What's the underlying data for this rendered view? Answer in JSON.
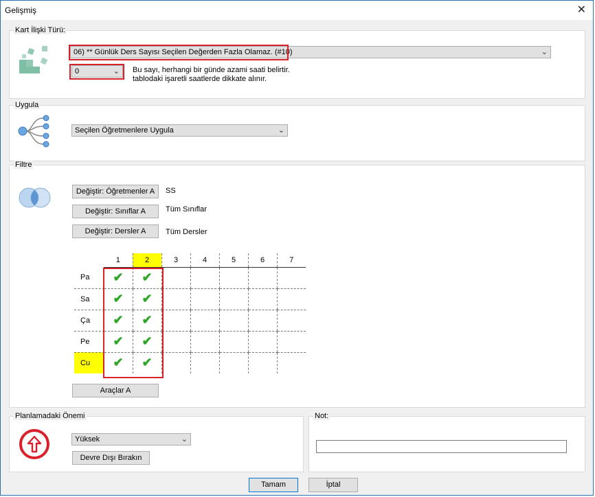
{
  "window": {
    "title": "Gelişmiş",
    "close_glyph": "✕"
  },
  "relation": {
    "legend": "Kart İlişki Türü:",
    "type_value": "06) ** Günlük Ders Sayısı Seçilen Değerden Fazla Olamaz. (#10)",
    "count_value": "0",
    "help_line1": "Bu sayı, herhangi bir günde azami saati belirtir.",
    "help_line2": "tablodaki işaretli saatlerde dikkate alınır."
  },
  "apply": {
    "legend": "Uygula",
    "value": "Seçilen Öğretmenlere Uygula"
  },
  "filter": {
    "legend": "Filtre",
    "rows": [
      {
        "button": "Değiştir: Öğretmenler A",
        "value": "SS"
      },
      {
        "button": "Değiştir: Sınıflar A",
        "value": "Tüm Sınıflar"
      },
      {
        "button": "Değiştir: Dersler A",
        "value": "Tüm Dersler"
      }
    ],
    "periods": [
      "1",
      "2",
      "3",
      "4",
      "5",
      "6",
      "7"
    ],
    "days": [
      "Pa",
      "Sa",
      "Ça",
      "Pe",
      "Cu"
    ],
    "check_glyph": "✔",
    "tools_button": "Araçlar A",
    "highlight_color": "#ffff00",
    "checked_periods": [
      "1",
      "2"
    ]
  },
  "importance": {
    "legend": "Planlamadaki Önemi",
    "value": "Yüksek",
    "disable_button": "Devre Dışı Bırakın"
  },
  "note": {
    "legend": "Not:",
    "value": ""
  },
  "footer": {
    "ok": "Tamam",
    "cancel": "İptal"
  },
  "colors": {
    "accent": "#2a6fb0",
    "highlight_red": "#d9212b",
    "check_green": "#2fa628",
    "importance_red": "#d9212b"
  },
  "icons": {
    "dropdown": "chevron-down-icon",
    "close": "close-icon"
  }
}
